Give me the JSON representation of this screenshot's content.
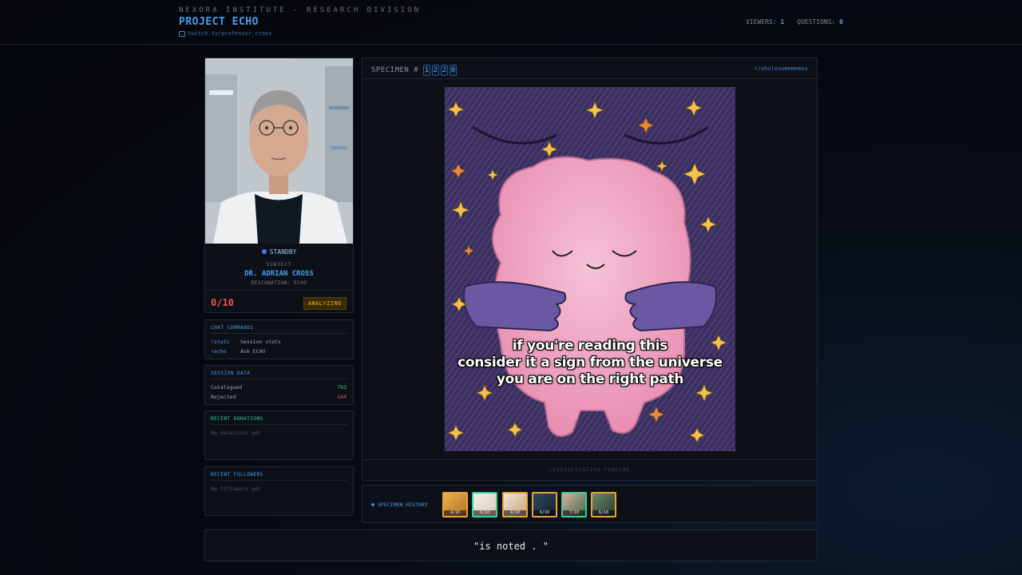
{
  "header": {
    "org": "NEXORA INSTITUTE - RESEARCH DIVISION",
    "project": "PROJECT ECHO",
    "channel": "twitch.tv/professor_cross",
    "viewers_label": "VIEWERS:",
    "viewers_value": "1",
    "questions_label": "QUESTIONS:",
    "questions_value": "0"
  },
  "subject": {
    "status": "STANDBY",
    "label": "SUBJECT",
    "name": "DR. ADRIAN CROSS",
    "designation": "DESIGNATION: ECHO",
    "score": "0/10",
    "analyzing": "ANALYZING"
  },
  "commands": {
    "title": "CHAT COMMANDS",
    "items": [
      {
        "cmd": "!stats",
        "desc": "Session stats"
      },
      {
        "cmd": "!echo",
        "desc": "Ask ECHO"
      }
    ]
  },
  "session": {
    "title": "SESSION DATA",
    "catalogued_label": "Catalogued",
    "catalogued_value": "793",
    "rejected_label": "Rejected",
    "rejected_value": "244"
  },
  "donations": {
    "title": "RECENT DONATIONS",
    "empty": "No donations yet"
  },
  "followers": {
    "title": "RECENT FOLLOWERS",
    "empty": "No followers yet"
  },
  "specimen": {
    "label": "SPECIMEN #",
    "digits": [
      "1",
      "2",
      "2",
      "0"
    ],
    "subreddit": "r/wholesomememes",
    "meme_lines": [
      "if you're reading this",
      "consider it a sign from the universe",
      "you are on the right path"
    ],
    "pending": "CLASSIFICATION PENDING"
  },
  "history": {
    "label": "SPECIMEN HISTORY",
    "items": [
      {
        "score": "4/10",
        "tone": "orange"
      },
      {
        "score": "6/10",
        "tone": "green"
      },
      {
        "score": "4/10",
        "tone": "orange"
      },
      {
        "score": "6/10",
        "tone": "orange"
      },
      {
        "score": "7/10",
        "tone": "green"
      },
      {
        "score": "6/10",
        "tone": "orange"
      }
    ]
  },
  "quote": "\"is noted . \"",
  "colors": {
    "accent": "#4b9cf5",
    "danger": "#f05252",
    "success": "#34d399",
    "warning": "#f0b432"
  }
}
